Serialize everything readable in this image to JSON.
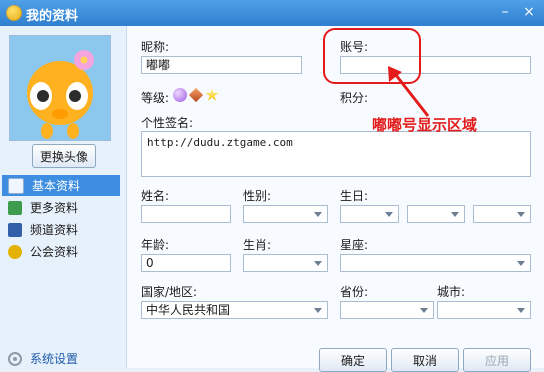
{
  "window": {
    "title": "我的资料",
    "minimize": "–",
    "close": "×"
  },
  "sidebar": {
    "change_avatar": "更换头像",
    "items": [
      {
        "label": "基本资料",
        "icon": "id-card-icon",
        "active": true
      },
      {
        "label": "更多资料",
        "icon": "card-icon",
        "active": false
      },
      {
        "label": "频道资料",
        "icon": "channel-icon",
        "active": false
      },
      {
        "label": "公会资料",
        "icon": "guild-shield-icon",
        "active": false
      }
    ],
    "system_settings": "系统设置"
  },
  "form": {
    "nickname_label": "昵称:",
    "nickname_value": "嘟嘟",
    "account_label": "账号:",
    "account_value": "",
    "level_label": "等级:",
    "points_label": "积分:",
    "signature_label": "个性签名:",
    "signature_value": "http://dudu.ztgame.com",
    "name_label": "姓名:",
    "name_value": "",
    "gender_label": "性别:",
    "gender_value": "",
    "birthday_label": "生日:",
    "birthday_year": "",
    "birthday_month": "",
    "birthday_day": "",
    "age_label": "年龄:",
    "age_value": "0",
    "zodiac_label": "生肖:",
    "zodiac_value": "",
    "constellation_label": "星座:",
    "constellation_value": "",
    "country_label": "国家/地区:",
    "country_value": "中华人民共和国",
    "province_label": "省份:",
    "province_value": "",
    "city_label": "城市:",
    "city_value": ""
  },
  "annotation": {
    "text": "嘟嘟号显示区域",
    "color": "#e31b1b"
  },
  "buttons": {
    "ok": "确定",
    "cancel": "取消",
    "apply": "应用"
  }
}
